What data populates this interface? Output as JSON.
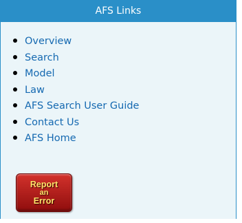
{
  "panel": {
    "title": "AFS Links",
    "header_color": "#2a8fc8",
    "body_color": "#ebf5f9",
    "link_color": "#1569b1"
  },
  "links": [
    {
      "label": "Overview",
      "name": "link-overview"
    },
    {
      "label": "Search",
      "name": "link-search"
    },
    {
      "label": "Model",
      "name": "link-model"
    },
    {
      "label": "Law",
      "name": "link-law"
    },
    {
      "label": "AFS Search User Guide",
      "name": "link-afs-search-user-guide"
    },
    {
      "label": "Contact Us",
      "name": "link-contact-us"
    },
    {
      "label": "AFS Home",
      "name": "link-afs-home"
    }
  ],
  "report_button": {
    "line1": "Report",
    "line2": "an",
    "line3": "Error",
    "color": "#c0201d",
    "text_color": "#ffe36a"
  }
}
